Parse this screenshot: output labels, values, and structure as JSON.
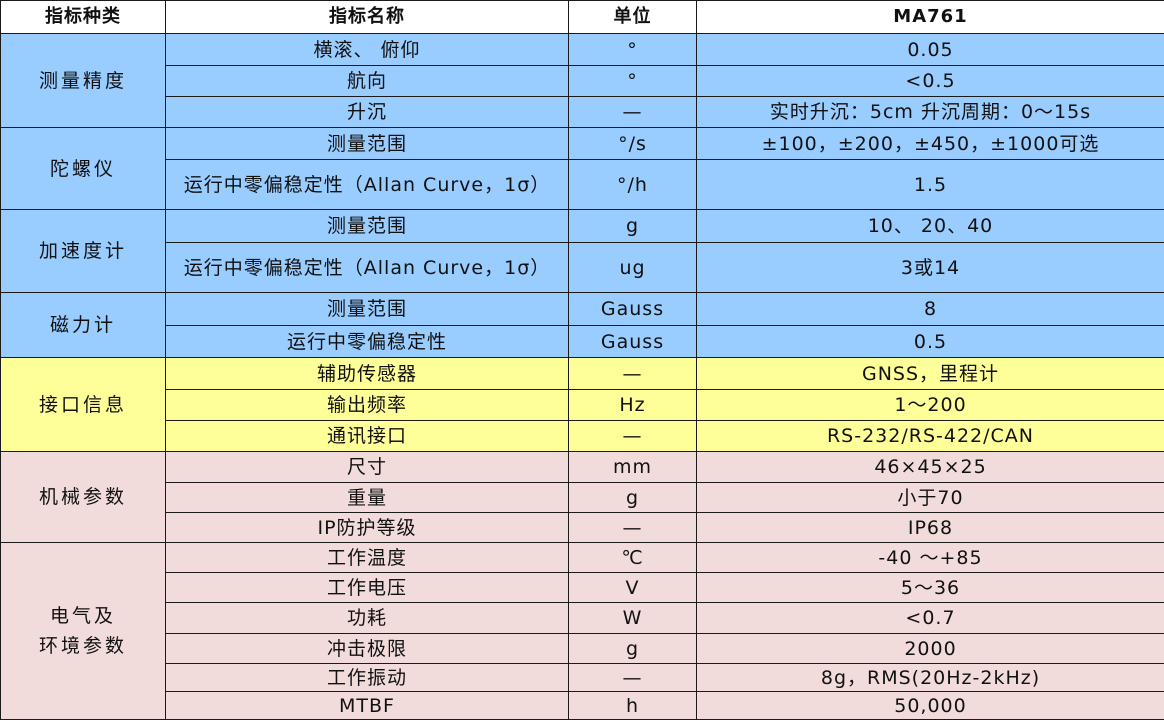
{
  "header": {
    "category": "指标种类",
    "name": "指标名称",
    "unit": "单位",
    "value": "MA761"
  },
  "groups": [
    {
      "category": "测量精度",
      "color": "#99ccff",
      "rows": [
        {
          "name": "横滚、 俯仰",
          "unit": "°",
          "value": "0.05"
        },
        {
          "name": "航向",
          "unit": "°",
          "value": "<0.5"
        },
        {
          "name": "升沉",
          "unit": "—",
          "value": "实时升沉：5cm   升沉周期：0～15s"
        }
      ]
    },
    {
      "category": "陀螺仪",
      "color": "#99ccff",
      "rows": [
        {
          "name": "测量范围",
          "unit": "°/s",
          "value": "±100，±200，±450，±1000可选"
        },
        {
          "name": "运行中零偏稳定性（Allan Curve，1σ）",
          "unit": "°/h",
          "value": "1.5"
        }
      ]
    },
    {
      "category": "加速度计",
      "color": "#99ccff",
      "rows": [
        {
          "name": "测量范围",
          "unit": "g",
          "value": "10、 20、40"
        },
        {
          "name": "运行中零偏稳定性（Allan Curve，1σ）",
          "unit": "ug",
          "value": "3或14"
        }
      ]
    },
    {
      "category": "磁力计",
      "color": "#99ccff",
      "rows": [
        {
          "name": "测量范围",
          "unit": "Gauss",
          "value": "8"
        },
        {
          "name": "运行中零偏稳定性",
          "unit": "Gauss",
          "value": "0.5"
        }
      ]
    },
    {
      "category": "接口信息",
      "color": "#ffff99",
      "rows": [
        {
          "name": "辅助传感器",
          "unit": "—",
          "value": "GNSS，里程计"
        },
        {
          "name": "输出频率",
          "unit": "Hz",
          "value": "1～200"
        },
        {
          "name": "通讯接口",
          "unit": "—",
          "value": "RS-232/RS-422/CAN"
        }
      ]
    },
    {
      "category": "机械参数",
      "color": "#f2dcdb",
      "rows": [
        {
          "name": "尺寸",
          "unit": "mm",
          "value": "46×45×25"
        },
        {
          "name": "重量",
          "unit": "g",
          "value": "小于70"
        },
        {
          "name": "IP防护等级",
          "unit": "—",
          "value": "IP68"
        }
      ]
    },
    {
      "category": "电气及环境参数",
      "category_lines": [
        "电气及",
        "环境参数"
      ],
      "color": "#f2dcdb",
      "rows": [
        {
          "name": "工作温度",
          "unit": "℃",
          "value": "-40 ～+85"
        },
        {
          "name": "工作电压",
          "unit": "V",
          "value": "5～36"
        },
        {
          "name": "功耗",
          "unit": "W",
          "value": "<0.7"
        },
        {
          "name": "冲击极限",
          "unit": "g",
          "value": "2000"
        },
        {
          "name": "工作振动",
          "unit": "—",
          "value": "8g，RMS(20Hz-2kHz)"
        },
        {
          "name": "MTBF",
          "unit": "h",
          "value": "50,000"
        }
      ]
    }
  ]
}
